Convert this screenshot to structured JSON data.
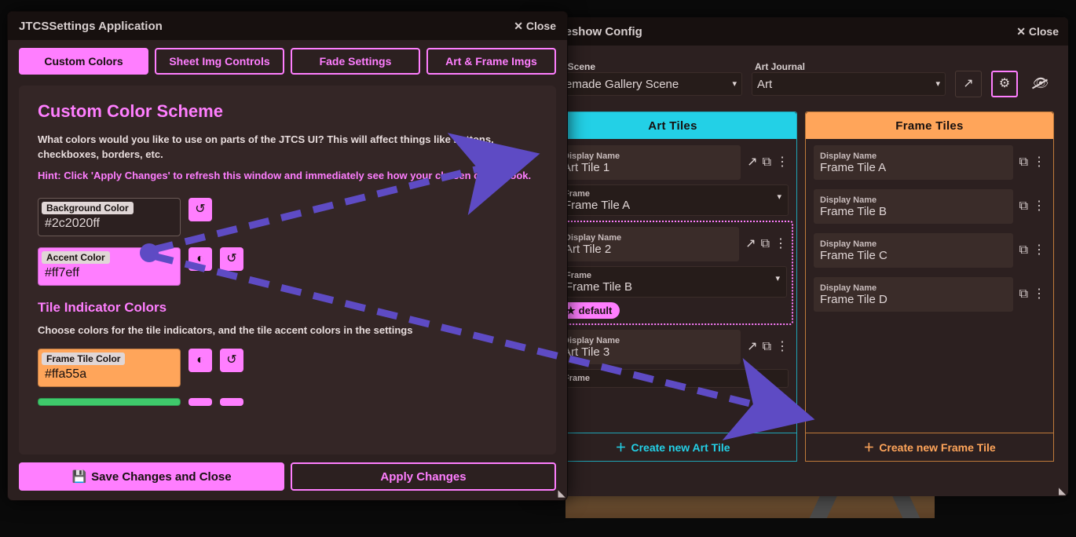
{
  "slideshow": {
    "title": "Slideshow Config",
    "close_label": "Close",
    "art_scene_label": "Art Scene",
    "art_scene_value": "Premade Gallery Scene",
    "art_journal_label": "Art Journal",
    "art_journal_value": "Art",
    "columns": {
      "art": {
        "header": "Art Tiles",
        "create_label": "Create new Art Tile",
        "display_name_label": "Display Name",
        "frame_label": "Frame",
        "default_badge": "default",
        "tiles": [
          {
            "name": "Art Tile 1",
            "frame": "Frame Tile A"
          },
          {
            "name": "Art Tile 2",
            "frame": "Frame Tile B",
            "default": true,
            "selected": true
          },
          {
            "name": "Art Tile 3",
            "frame": ""
          }
        ]
      },
      "frame": {
        "header": "Frame Tiles",
        "create_label": "Create new Frame Tile",
        "display_name_label": "Display Name",
        "tiles": [
          {
            "name": "Frame Tile A"
          },
          {
            "name": "Frame Tile B"
          },
          {
            "name": "Frame Tile C"
          },
          {
            "name": "Frame Tile D"
          }
        ]
      }
    }
  },
  "jtcs": {
    "title": "JTCSSettings Application",
    "close_label": "Close",
    "tabs": [
      "Custom Colors",
      "Sheet Img Controls",
      "Fade Settings",
      "Art & Frame Imgs"
    ],
    "section_title": "Custom Color Scheme",
    "section_desc": "What colors would you like to use on parts of the JTCS UI? This will affect things like buttons, checkboxes, borders, etc.",
    "hint": "Hint: Click 'Apply Changes' to refresh this window and immediately see how your chosen colors look.",
    "bg_color_label": "Background Color",
    "bg_color_value": "#2c2020ff",
    "accent_color_label": "Accent Color",
    "accent_color_value": "#ff7eff",
    "tile_section_title": "Tile Indicator Colors",
    "tile_section_desc": "Choose colors for the tile indicators, and the tile accent colors in the settings",
    "frame_tile_color_label": "Frame Tile Color",
    "frame_tile_color_value": "#ffa55a",
    "save_label": "Save Changes and Close",
    "apply_label": "Apply Changes"
  },
  "colors": {
    "accent": "#ff7eff",
    "frame": "#ffa55a",
    "art": "#23d0e6",
    "bg": "#2c2020",
    "arrow": "#5e4bc4"
  }
}
